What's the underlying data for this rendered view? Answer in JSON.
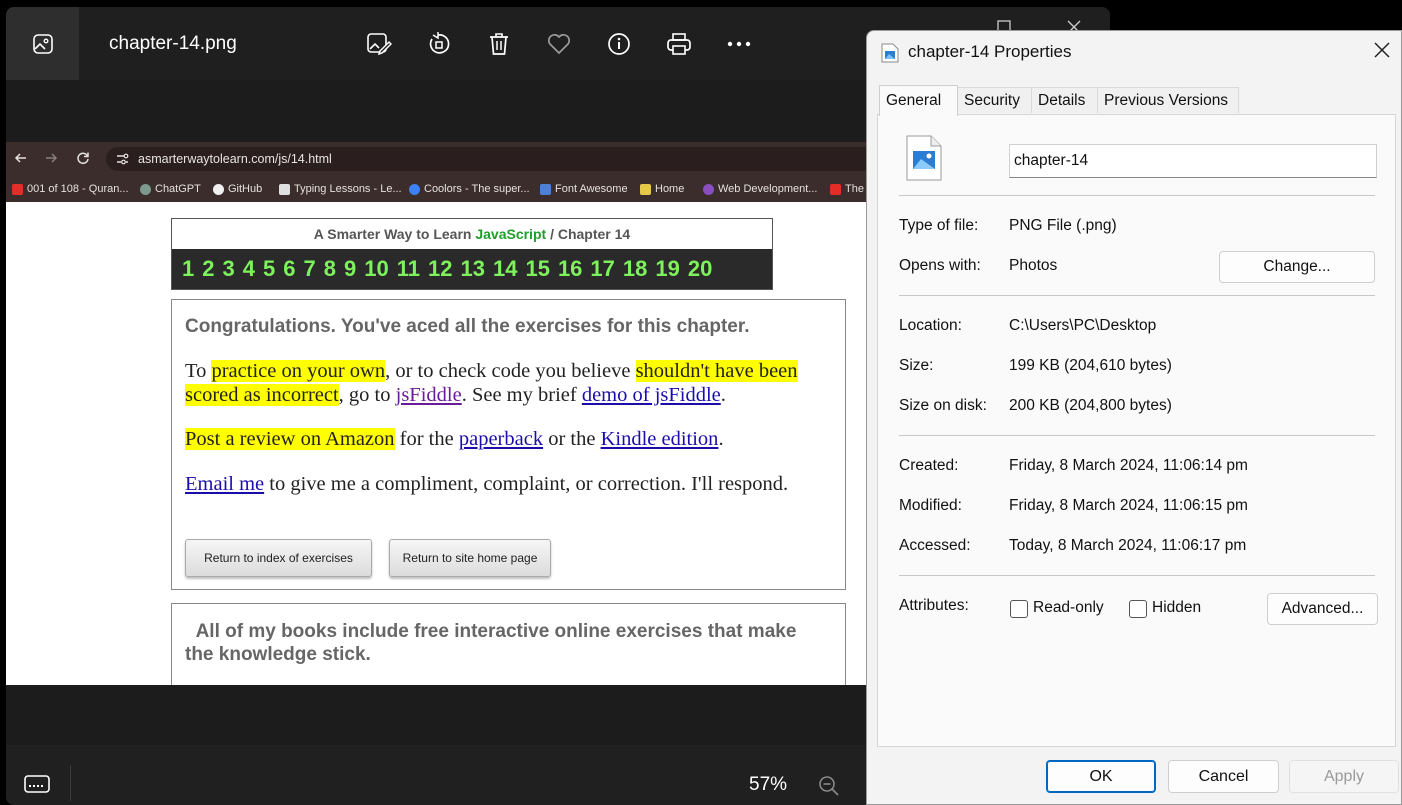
{
  "photos": {
    "filename": "chapter-14.png",
    "zoom": "57%",
    "toolbar_icons": [
      "edit-image-icon",
      "rotate-icon",
      "delete-icon",
      "favorite-icon",
      "info-icon",
      "print-icon",
      "more-icon"
    ]
  },
  "browser": {
    "url": "asmarterwaytolearn.com/js/14.html",
    "bookmarks": [
      "001 of 108 - Quran...",
      "ChatGPT",
      "GitHub",
      "Typing Lessons - Le...",
      "Coolors - The super...",
      "Font Awesome",
      "Home",
      "Web Development...",
      "The"
    ]
  },
  "page": {
    "header_prefix": "A Smarter Way to Learn",
    "header_lang": "JavaScript",
    "header_suffix": "/  Chapter 14",
    "chapters": [
      "1",
      "2",
      "3",
      "4",
      "5",
      "6",
      "7",
      "8",
      "9",
      "10",
      "11",
      "12",
      "13",
      "14",
      "15",
      "16",
      "17",
      "18",
      "19",
      "20"
    ],
    "congrats": "Congratulations. You've aced all the exercises for this chapter.",
    "p1": {
      "t1": "To ",
      "h1": "practice on your own",
      "t2": ", or to check code you believe ",
      "h2": "shouldn't have been scored as incorrect",
      "t3": ", go to ",
      "l1": "jsFiddle",
      "t4": ". See my brief ",
      "l2": "demo of jsFiddle",
      "t5": "."
    },
    "p2": {
      "h1": "Post a review on Amazon",
      "t1": " for the ",
      "l1": "paperback",
      "t2": " or the ",
      "l2": "Kindle edition",
      "t3": "."
    },
    "p3": {
      "l1": "Email me",
      "t1": " to give me a compliment, complaint, or correction. I'll respond."
    },
    "btn_index": "Return to index of exercises",
    "btn_home": "Return to site home page",
    "box2_text": "All of my books include free interactive online exercises that make the knowledge stick."
  },
  "dialog": {
    "title": "chapter-14 Properties",
    "tabs": [
      "General",
      "Security",
      "Details",
      "Previous Versions"
    ],
    "name": "chapter-14",
    "type_label": "Type of file:",
    "type_value": "PNG File (.png)",
    "opens_label": "Opens with:",
    "opens_value": "Photos",
    "change_btn": "Change...",
    "location_label": "Location:",
    "location_value": "C:\\Users\\PC\\Desktop",
    "size_label": "Size:",
    "size_value": "199 KB (204,610 bytes)",
    "sod_label": "Size on disk:",
    "sod_value": "200 KB (204,800 bytes)",
    "created_label": "Created:",
    "created_value": "Friday, 8 March 2024, 11:06:14 pm",
    "modified_label": "Modified:",
    "modified_value": "Friday, 8 March 2024, 11:06:15 pm",
    "accessed_label": "Accessed:",
    "accessed_value": "Today, 8 March 2024, 11:06:17 pm",
    "attributes_label": "Attributes:",
    "readonly_label": "Read-only",
    "hidden_label": "Hidden",
    "advanced_btn": "Advanced...",
    "ok": "OK",
    "cancel": "Cancel",
    "apply": "Apply"
  },
  "colors": {
    "accent": "#0067c0",
    "highlight": "#ffff00",
    "chapter_numbers": "#7ef25c"
  }
}
